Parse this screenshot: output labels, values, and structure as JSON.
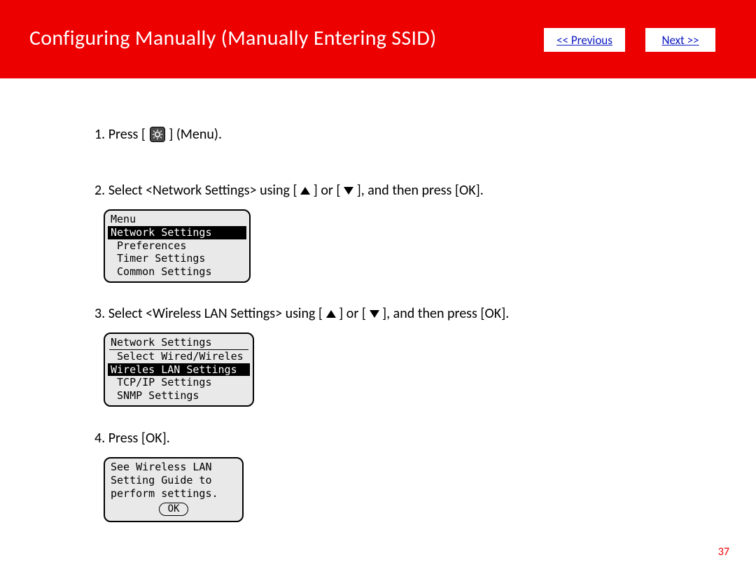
{
  "header": {
    "title": "Configuring Manually (Manually Entering SSID)",
    "prev_label": "<< Previous",
    "next_label": "Next >>"
  },
  "steps": {
    "s1_a": "1. Press [",
    "s1_b": "] (Menu).",
    "s2_a": "2. Select <Network Settings> using [",
    "s2_b": "] or [",
    "s2_c": "], and then press [OK].",
    "s3_a": "3. Select <Wireless LAN Settings> using [",
    "s3_b": "] or [",
    "s3_c": "], and then press [OK].",
    "s4": "4. Press [OK]."
  },
  "lcd1": {
    "title": "Menu",
    "sel": "Network Settings",
    "r2": " Preferences",
    "r3": " Timer Settings",
    "r4": " Common Settings"
  },
  "lcd2": {
    "title": "Network Settings",
    "r1": " Select Wired/Wireles",
    "sel": "Wireles LAN Settings",
    "r3": " TCP/IP Settings",
    "r4": " SNMP Settings"
  },
  "lcd3": {
    "l1": "See Wireless LAN",
    "l2": "Setting Guide to",
    "l3": "perform settings.",
    "ok": "OK"
  },
  "page_number": "37"
}
